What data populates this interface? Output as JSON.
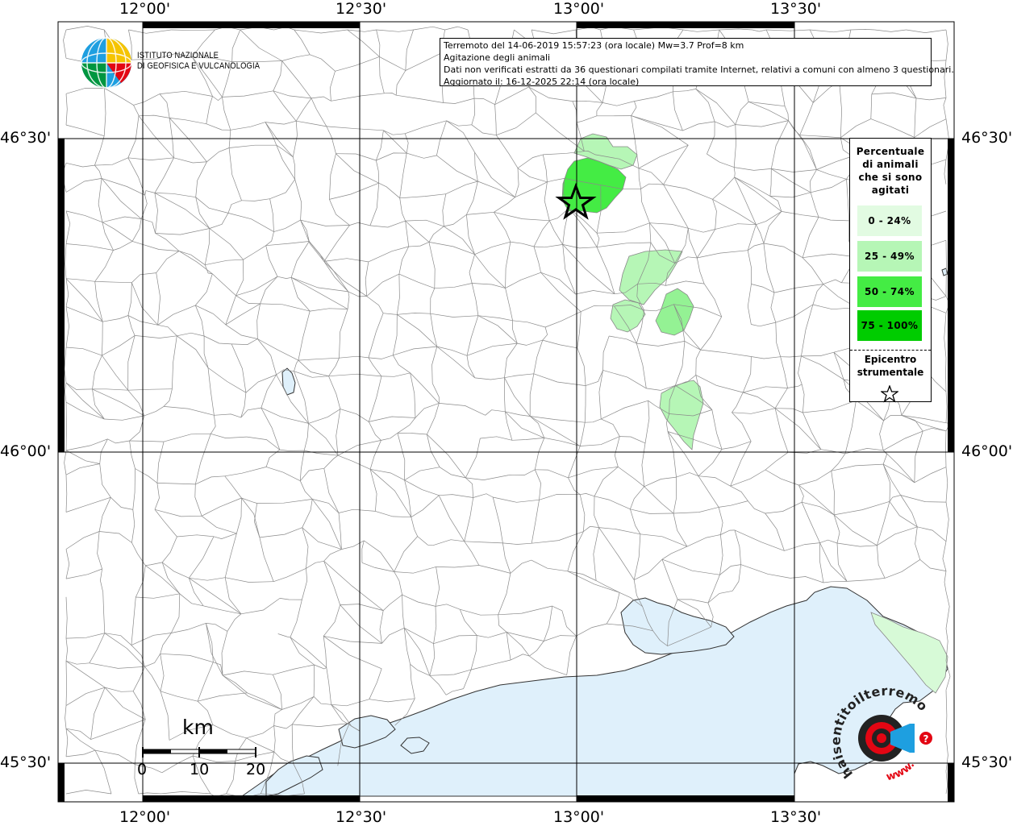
{
  "map": {
    "title_lines": [
      "Terremoto del 14-06-2019 15:57:23 (ora locale) Mw=3.7 Prof=8 km",
      "Agitazione degli animali",
      "Dati non verificati estratti da 36 questionari compilati tramite Internet, relativi a comuni con almeno 3 questionari.",
      "Aggiornato il: 16-12-2025 22:14 (ora locale)"
    ],
    "lon_labels": [
      "12°00'",
      "12°30'",
      "13°00'",
      "13°30'"
    ],
    "lat_labels": [
      "46°30'",
      "46°00'",
      "45°30'"
    ],
    "sea_color": "#dff0fb",
    "border_color": "#8a8a8a"
  },
  "logo": {
    "line1": "ISTITUTO NAZIONALE",
    "line2": "DI GEOFISICA E VULCANOLOGIA"
  },
  "legend": {
    "title_lines": [
      "Percentuale",
      "di animali",
      "che si sono",
      "agitati"
    ],
    "classes": [
      {
        "label": "0 - 24%",
        "color": "#e2fbe2"
      },
      {
        "label": "25 - 49%",
        "color": "#b6f6b6"
      },
      {
        "label": "50 - 74%",
        "color": "#44ec44"
      },
      {
        "label": "75 - 100%",
        "color": "#00cc00"
      }
    ],
    "epicenter_lines": [
      "Epicentro",
      "strumentale"
    ],
    "epicenter_icon": "star-icon"
  },
  "scalebar": {
    "unit": "km",
    "ticks": [
      "0",
      "10",
      "20"
    ]
  },
  "watermark": {
    "text": "haisentitoilterremoto.it",
    "url_text": "www.",
    "colors": {
      "red": "#e30613",
      "blue": "#1e9fe0",
      "dark": "#222222"
    }
  }
}
